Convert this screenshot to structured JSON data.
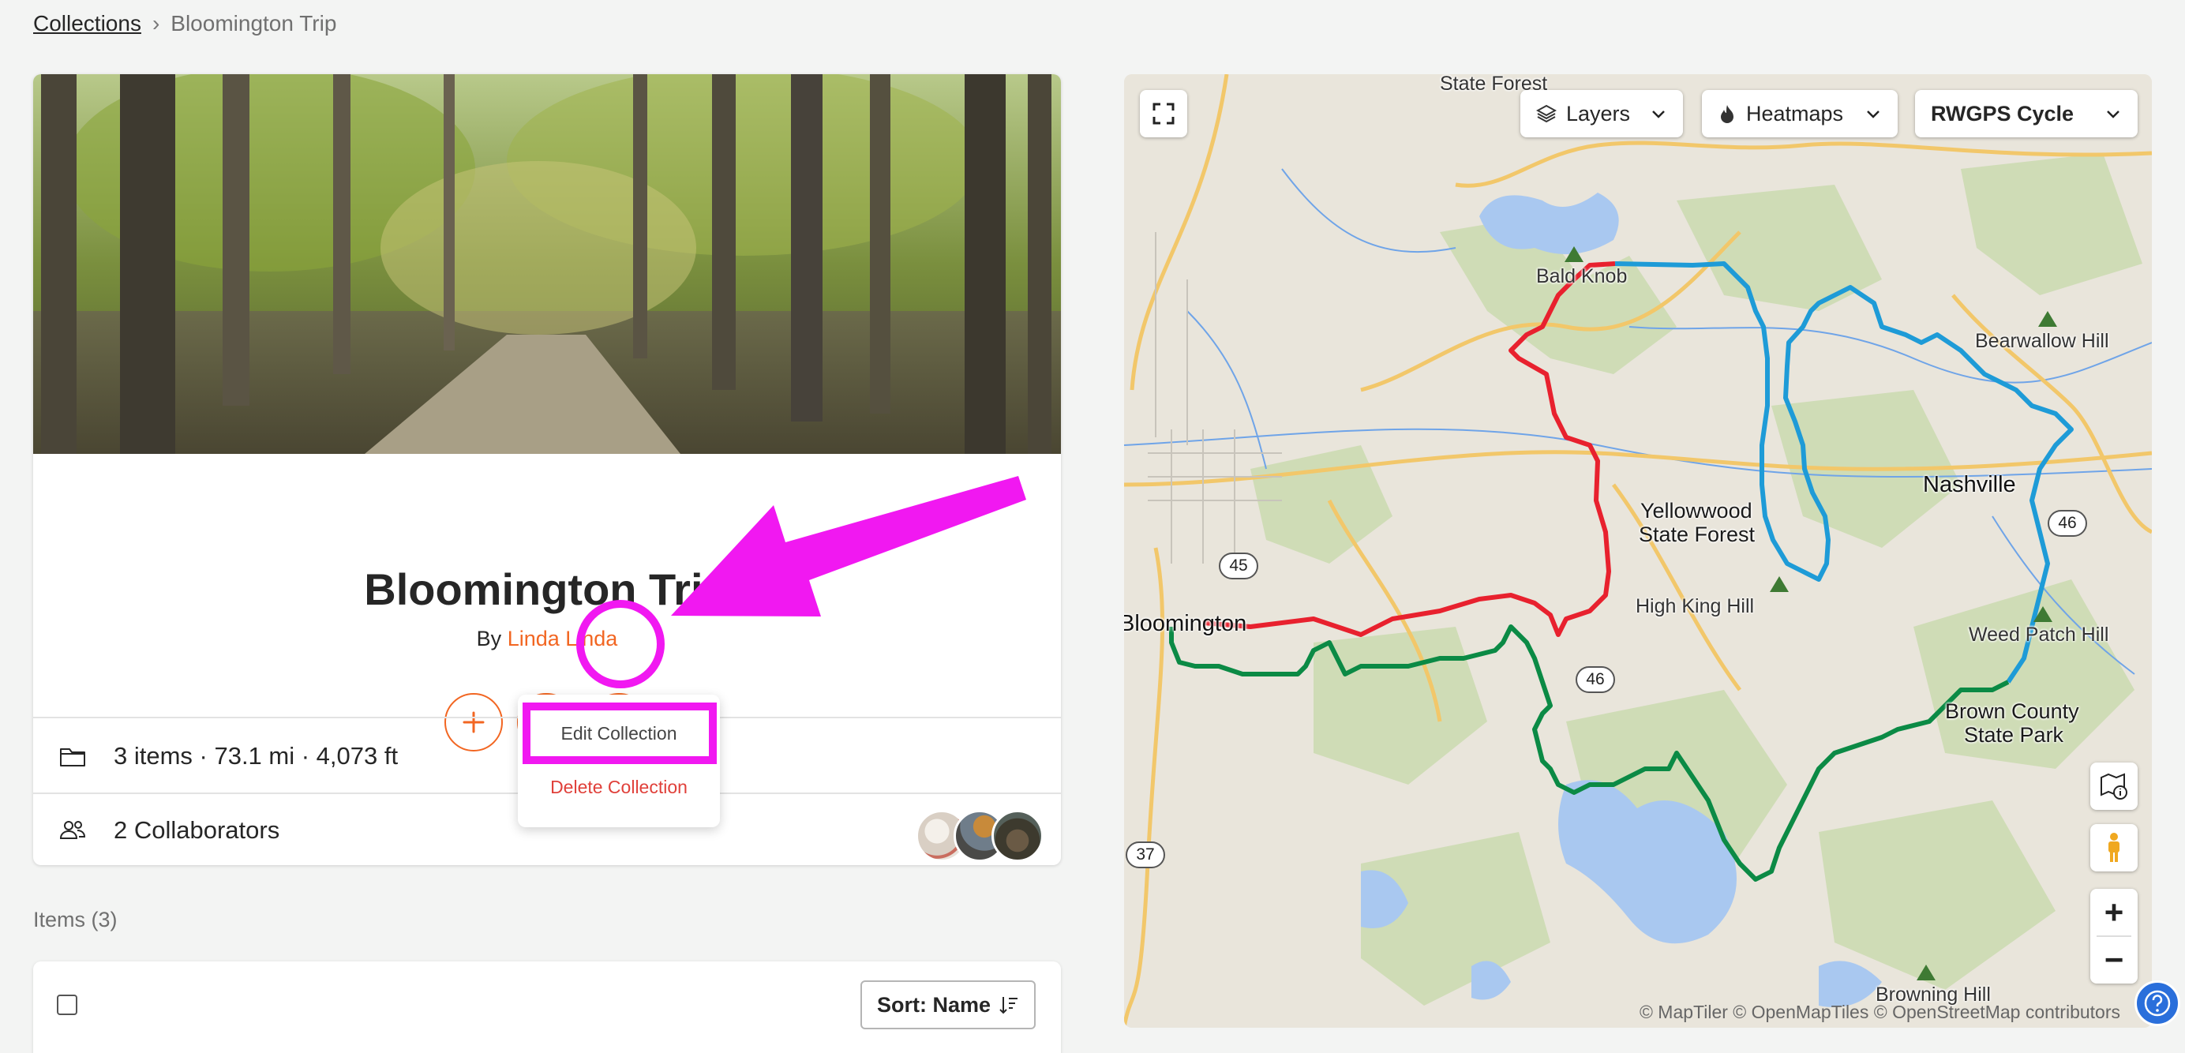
{
  "breadcrumb": {
    "root": "Collections",
    "separator": "›",
    "current": "Bloomington Trip"
  },
  "collection": {
    "title": "Bloomington Trip",
    "by_prefix": "By",
    "author": "Linda Linda",
    "stats": "3 items · 73.1 mi · 4,073 ft",
    "collaborators": "2 Collaborators"
  },
  "actions": {
    "add_icon": "plus-icon",
    "share_icon": "share-icon",
    "more_icon": "ellipsis-icon"
  },
  "menu": {
    "edit": "Edit Collection",
    "delete": "Delete Collection"
  },
  "items": {
    "label": "Items (3)",
    "sort_label": "Sort: Name"
  },
  "map": {
    "layers_label": "Layers",
    "heatmaps_label": "Heatmaps",
    "style_label": "RWGPS Cycle",
    "labels": {
      "state_forest": "State Forest",
      "bald_knob": "Bald Knob",
      "bearwallow": "Bearwallow Hill",
      "nashville": "Nashville",
      "yellowwood_1": "Yellowwood",
      "yellowwood_2": "State Forest",
      "high_king": "High King Hill",
      "weed_patch": "Weed Patch Hill",
      "bloomington": "Bloomington",
      "brown_1": "Brown County",
      "brown_2": "State Park",
      "browning": "Browning Hill"
    },
    "shields": {
      "r45": "45",
      "r46a": "46",
      "r46b": "46",
      "r37": "37"
    },
    "attribution": "© MapTiler © OpenMapTiles © OpenStreetMap contributors",
    "route_colors": {
      "red": "#e8212e",
      "blue": "#1e9bd7",
      "green": "#0b8a45"
    }
  },
  "colors": {
    "accent": "#f26622",
    "highlight": "#f118f1",
    "danger": "#e0403a"
  }
}
